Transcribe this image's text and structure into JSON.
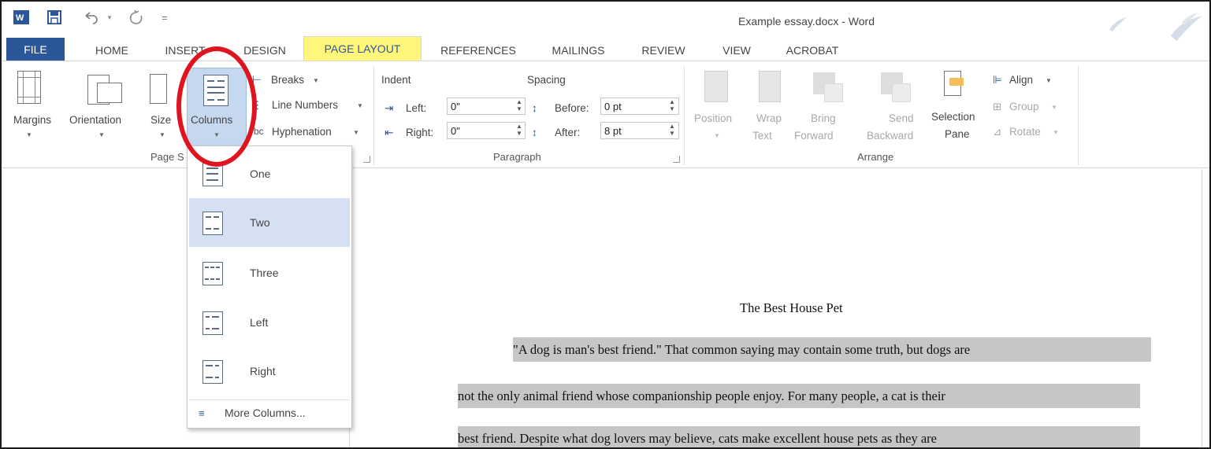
{
  "window": {
    "title": "Example essay.docx - Word",
    "app_icon": "word-icon",
    "qat": {
      "save_icon": "save-icon",
      "undo_icon": "undo-icon",
      "redo_icon": "redo-icon",
      "customize_glyph": "="
    }
  },
  "tabs": [
    "FILE",
    "HOME",
    "INSERT",
    "DESIGN",
    "PAGE LAYOUT",
    "REFERENCES",
    "MAILINGS",
    "REVIEW",
    "VIEW",
    "ACROBAT"
  ],
  "active_tab": "PAGE LAYOUT",
  "ribbon": {
    "page_setup": {
      "group_label": "Page S",
      "margins": "Margins",
      "orientation": "Orientation",
      "size": "Size",
      "columns": "Columns",
      "breaks": "Breaks",
      "line_numbers": "Line Numbers",
      "hyphenation": "Hyphenation"
    },
    "paragraph": {
      "group_label": "Paragraph",
      "indent_label": "Indent",
      "spacing_label": "Spacing",
      "left_label": "Left:",
      "left_value": "0\"",
      "right_label": "Right:",
      "right_value": "0\"",
      "before_label": "Before:",
      "before_value": "0 pt",
      "after_label": "After:",
      "after_value": "8 pt"
    },
    "arrange": {
      "group_label": "Arrange",
      "position": "Position",
      "wrap_text_1": "Wrap",
      "wrap_text_2": "Text",
      "bring_forward_1": "Bring",
      "bring_forward_2": "Forward",
      "send_backward_1": "Send",
      "send_backward_2": "Backward",
      "selection_pane_1": "Selection",
      "selection_pane_2": "Pane",
      "align": "Align",
      "group": "Group",
      "rotate": "Rotate"
    }
  },
  "columns_menu": {
    "items": [
      "One",
      "Two",
      "Three",
      "Left",
      "Right"
    ],
    "hovered": "Two",
    "more_columns": "More Columns..."
  },
  "document": {
    "title": "The Best House Pet",
    "lines": [
      "\"A dog is man's best friend.\" That common saying may contain some truth, but dogs are",
      "not the only animal friend whose companionship people enjoy. For many people, a cat is their",
      "best friend. Despite what dog lovers may believe, cats make excellent house pets as they are"
    ]
  },
  "colors": {
    "word_blue": "#2b579a",
    "tab_highlight": "#fff67a",
    "annotation_red": "#e0141e",
    "menu_hover": "#d5e1f2",
    "selection_gray": "#c6c6c6"
  }
}
